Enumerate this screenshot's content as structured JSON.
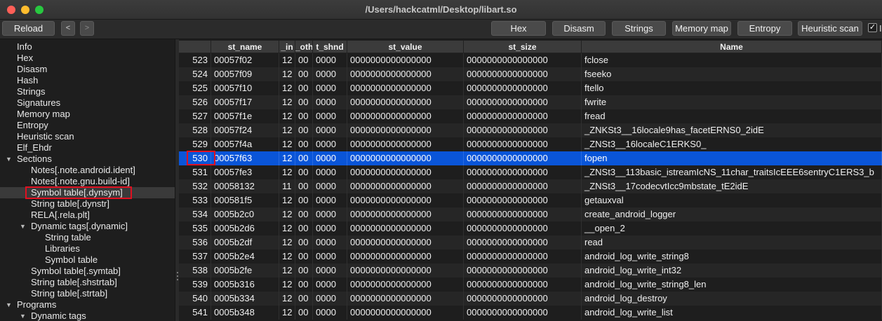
{
  "window": {
    "title": "/Users/hackcatml/Desktop/libart.so"
  },
  "toolbar": {
    "reload": "Reload",
    "back": "<",
    "forward": ">",
    "hex": "Hex",
    "disasm": "Disasm",
    "strings": "Strings",
    "memory_map": "Memory map",
    "entropy": "Entropy",
    "heuristic_scan": "Heuristic scan",
    "checkbox_checked": "✓",
    "checkbox_label": "I"
  },
  "sidebar": {
    "items": [
      {
        "label": "Info"
      },
      {
        "label": "Hex"
      },
      {
        "label": "Disasm"
      },
      {
        "label": "Hash"
      },
      {
        "label": "Strings"
      },
      {
        "label": "Signatures"
      },
      {
        "label": "Memory map"
      },
      {
        "label": "Entropy"
      },
      {
        "label": "Heuristic scan"
      },
      {
        "label": "Elf_Ehdr"
      },
      {
        "label": "Sections"
      },
      {
        "label": "Notes[.note.android.ident]"
      },
      {
        "label": "Notes[.note.gnu.build-id]"
      },
      {
        "label": "Symbol table[.dynsym]"
      },
      {
        "label": "String table[.dynstr]"
      },
      {
        "label": "RELA[.rela.plt]"
      },
      {
        "label": "Dynamic tags[.dynamic]"
      },
      {
        "label": "String table"
      },
      {
        "label": "Libraries"
      },
      {
        "label": "Symbol table"
      },
      {
        "label": "Symbol table[.symtab]"
      },
      {
        "label": "String table[.shstrtab]"
      },
      {
        "label": "String table[.strtab]"
      },
      {
        "label": "Programs"
      },
      {
        "label": "Dynamic tags"
      }
    ]
  },
  "table": {
    "columns": [
      "",
      "st_name",
      "_in",
      "_oth",
      "t_shnd",
      "st_value",
      "st_size",
      "Name"
    ],
    "rows": [
      [
        "523",
        "00057f02",
        "12",
        "00",
        "0000",
        "0000000000000000",
        "0000000000000000",
        "fclose"
      ],
      [
        "524",
        "00057f09",
        "12",
        "00",
        "0000",
        "0000000000000000",
        "0000000000000000",
        "fseeko"
      ],
      [
        "525",
        "00057f10",
        "12",
        "00",
        "0000",
        "0000000000000000",
        "0000000000000000",
        "ftello"
      ],
      [
        "526",
        "00057f17",
        "12",
        "00",
        "0000",
        "0000000000000000",
        "0000000000000000",
        "fwrite"
      ],
      [
        "527",
        "00057f1e",
        "12",
        "00",
        "0000",
        "0000000000000000",
        "0000000000000000",
        "fread"
      ],
      [
        "528",
        "00057f24",
        "12",
        "00",
        "0000",
        "0000000000000000",
        "0000000000000000",
        "_ZNKSt3__16locale9has_facetERNS0_2idE"
      ],
      [
        "529",
        "00057f4a",
        "12",
        "00",
        "0000",
        "0000000000000000",
        "0000000000000000",
        "_ZNSt3__16localeC1ERKS0_"
      ],
      [
        "530",
        "00057f63",
        "12",
        "00",
        "0000",
        "0000000000000000",
        "0000000000000000",
        "fopen"
      ],
      [
        "531",
        "00057fe3",
        "12",
        "00",
        "0000",
        "0000000000000000",
        "0000000000000000",
        "_ZNSt3__113basic_istreamIcNS_11char_traitsIcEEE6sentryC1ERS3_b"
      ],
      [
        "532",
        "00058132",
        "11",
        "00",
        "0000",
        "0000000000000000",
        "0000000000000000",
        "_ZNSt3__17codecvtIcc9mbstate_tE2idE"
      ],
      [
        "533",
        "000581f5",
        "12",
        "00",
        "0000",
        "0000000000000000",
        "0000000000000000",
        "getauxval"
      ],
      [
        "534",
        "0005b2c0",
        "12",
        "00",
        "0000",
        "0000000000000000",
        "0000000000000000",
        "create_android_logger"
      ],
      [
        "535",
        "0005b2d6",
        "12",
        "00",
        "0000",
        "0000000000000000",
        "0000000000000000",
        "__open_2"
      ],
      [
        "536",
        "0005b2df",
        "12",
        "00",
        "0000",
        "0000000000000000",
        "0000000000000000",
        "read"
      ],
      [
        "537",
        "0005b2e4",
        "12",
        "00",
        "0000",
        "0000000000000000",
        "0000000000000000",
        "android_log_write_string8"
      ],
      [
        "538",
        "0005b2fe",
        "12",
        "00",
        "0000",
        "0000000000000000",
        "0000000000000000",
        "android_log_write_int32"
      ],
      [
        "539",
        "0005b316",
        "12",
        "00",
        "0000",
        "0000000000000000",
        "0000000000000000",
        "android_log_write_string8_len"
      ],
      [
        "540",
        "0005b334",
        "12",
        "00",
        "0000",
        "0000000000000000",
        "0000000000000000",
        "android_log_destroy"
      ],
      [
        "541",
        "0005b348",
        "12",
        "00",
        "0000",
        "0000000000000000",
        "0000000000000000",
        "android_log_write_list"
      ]
    ],
    "selected_row": "530"
  },
  "colors": {
    "selection": "#0a55d8",
    "highlight_box": "#e01020"
  }
}
